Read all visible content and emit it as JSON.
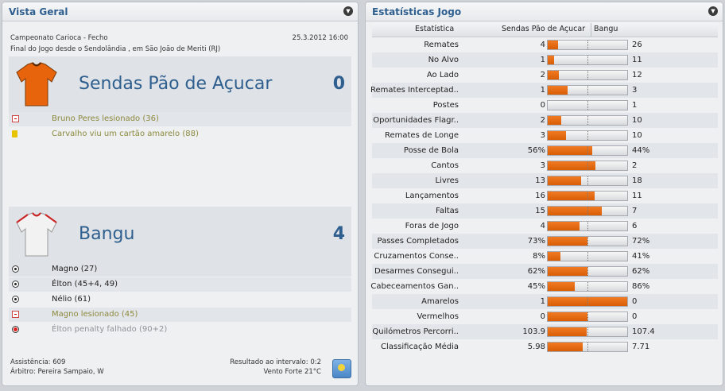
{
  "left_panel": {
    "title": "Vista Geral",
    "competition": "Campeonato Carioca - Fecho",
    "datetime": "25.3.2012 16:00",
    "venue": "Final do Jogo desde o Sendolândia , em São João de Meriti (RJ)",
    "home": {
      "name": "Sendas Pão de Açucar",
      "score": "0",
      "shirt_color": "#e8640c",
      "events": [
        {
          "icon": "injury-icon",
          "text": "Bruno Peres lesionado (36)",
          "style": "olive"
        },
        {
          "icon": "yellow-card-icon",
          "text": "Carvalho viu um cartão amarelo (88)",
          "style": "olive"
        }
      ]
    },
    "away": {
      "name": "Bangu",
      "score": "4",
      "shirt_color": "#f2f2f2",
      "events": [
        {
          "icon": "goal-icon",
          "text": "Magno (27)",
          "style": "normal"
        },
        {
          "icon": "goal-icon",
          "text": "Élton (45+4, 49)",
          "style": "normal"
        },
        {
          "icon": "goal-icon",
          "text": "Nélio (61)",
          "style": "normal"
        },
        {
          "icon": "injury-icon",
          "text": "Magno lesionado (45)",
          "style": "olive"
        },
        {
          "icon": "penalty-miss-icon",
          "text": "Élton penalty falhado (90+2)",
          "style": "muted"
        }
      ]
    },
    "footer": {
      "attendance": "Assistência: 609",
      "referee": "Árbitro: Pereira Sampaio, W",
      "halftime": "Resultado ao intervalo: 0:2",
      "weather": "Vento Forte 21°C"
    }
  },
  "right_panel": {
    "title": "Estatísticas Jogo",
    "header": {
      "stat": "Estatística",
      "home": "Sendas Pão de Açucar",
      "away": "Bangu"
    },
    "rows": [
      {
        "label": "Remates",
        "home": "4",
        "away": "26",
        "share": 0.13
      },
      {
        "label": "No Alvo",
        "home": "1",
        "away": "11",
        "share": 0.08
      },
      {
        "label": "Ao Lado",
        "home": "2",
        "away": "12",
        "share": 0.14
      },
      {
        "label": "Remates Interceptad..",
        "home": "1",
        "away": "3",
        "share": 0.25
      },
      {
        "label": "Postes",
        "home": "0",
        "away": "1",
        "share": 0.0
      },
      {
        "label": "Oportunidades Flagr..",
        "home": "2",
        "away": "10",
        "share": 0.17
      },
      {
        "label": "Remates de Longe",
        "home": "3",
        "away": "10",
        "share": 0.23
      },
      {
        "label": "Posse de Bola",
        "home": "56%",
        "away": "44%",
        "share": 0.56
      },
      {
        "label": "Cantos",
        "home": "3",
        "away": "2",
        "share": 0.6
      },
      {
        "label": "Livres",
        "home": "13",
        "away": "18",
        "share": 0.42
      },
      {
        "label": "Lançamentos",
        "home": "16",
        "away": "11",
        "share": 0.59
      },
      {
        "label": "Faltas",
        "home": "15",
        "away": "7",
        "share": 0.68
      },
      {
        "label": "Foras de Jogo",
        "home": "4",
        "away": "6",
        "share": 0.4
      },
      {
        "label": "Passes Completados",
        "home": "73%",
        "away": "72%",
        "share": 0.5
      },
      {
        "label": "Cruzamentos Conse..",
        "home": "8%",
        "away": "41%",
        "share": 0.16
      },
      {
        "label": "Desarmes Consegui..",
        "home": "62%",
        "away": "62%",
        "share": 0.5
      },
      {
        "label": "Cabeceamentos Gan..",
        "home": "45%",
        "away": "86%",
        "share": 0.34
      },
      {
        "label": "Amarelos",
        "home": "1",
        "away": "0",
        "share": 1.0
      },
      {
        "label": "Vermelhos",
        "home": "0",
        "away": "0",
        "share": 0.5
      },
      {
        "label": "Quilómetros Percorri..",
        "home": "103.9",
        "away": "107.4",
        "share": 0.49
      },
      {
        "label": "Classificação Média",
        "home": "5.98",
        "away": "7.71",
        "share": 0.44
      }
    ],
    "colors": {
      "home_bar": "#e8640c",
      "bar_track": "#e4e5e7"
    }
  }
}
